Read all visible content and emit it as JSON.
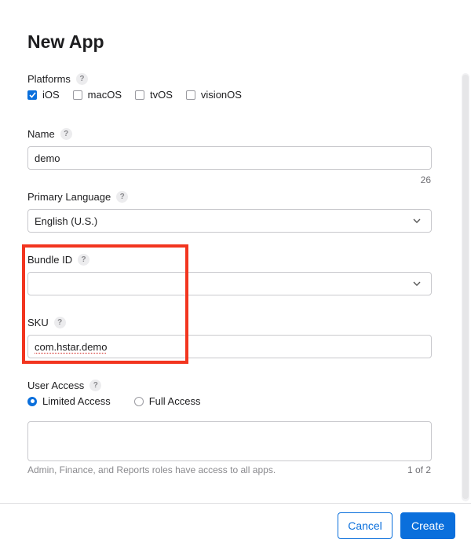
{
  "dialog": {
    "title": "New App",
    "help_glyph": "?",
    "platforms": {
      "label": "Platforms",
      "options": [
        {
          "label": "iOS",
          "checked": true
        },
        {
          "label": "macOS",
          "checked": false
        },
        {
          "label": "tvOS",
          "checked": false
        },
        {
          "label": "visionOS",
          "checked": false
        }
      ]
    },
    "name": {
      "label": "Name",
      "value": "demo",
      "remaining": "26"
    },
    "primary_language": {
      "label": "Primary Language",
      "value": "English (U.S.)"
    },
    "bundle_id": {
      "label": "Bundle ID",
      "value": ""
    },
    "sku": {
      "label": "SKU",
      "value": "com.hstar.demo"
    },
    "user_access": {
      "label": "User Access",
      "options": [
        {
          "label": "Limited Access",
          "selected": true
        },
        {
          "label": "Full Access",
          "selected": false
        }
      ],
      "hint": "Admin, Finance, and Reports roles have access to all apps.",
      "page": "1 of 2"
    },
    "buttons": {
      "cancel": "Cancel",
      "create": "Create"
    }
  },
  "colors": {
    "accent": "#0a6fdc",
    "highlight": "#f2351f"
  },
  "icons": {
    "checkbox_checked": "checkmark-icon",
    "select": "chevron-down-icon",
    "help": "question-icon"
  }
}
